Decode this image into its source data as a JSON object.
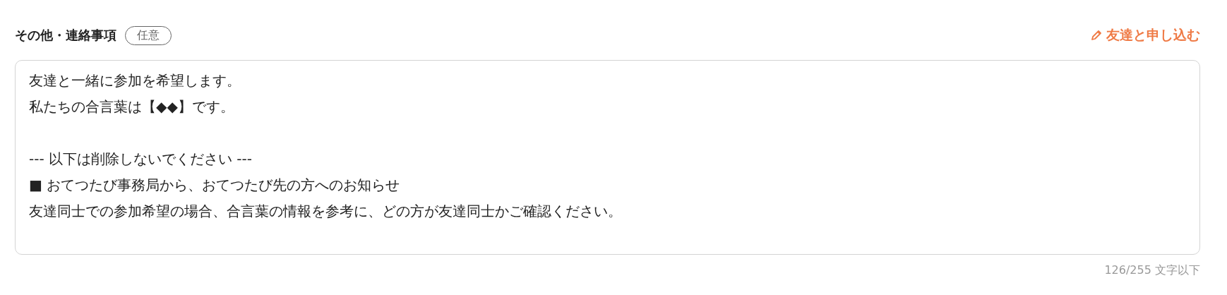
{
  "field": {
    "label": "その他・連絡事項",
    "badge": "任意",
    "action": "友達と申し込む",
    "paragraphs": [
      [
        "友達と一緒に参加を希望します。",
        "私たちの合言葉は【◆◆】です。"
      ],
      [
        "--- 以下は削除しないでください ---",
        "■ おてつたび事務局から、おてつたび先の方へのお知らせ",
        "友達同士での参加希望の場合、合言葉の情報を参考に、どの方が友達同士かご確認ください。"
      ]
    ],
    "counter": "126/255 文字以下"
  }
}
